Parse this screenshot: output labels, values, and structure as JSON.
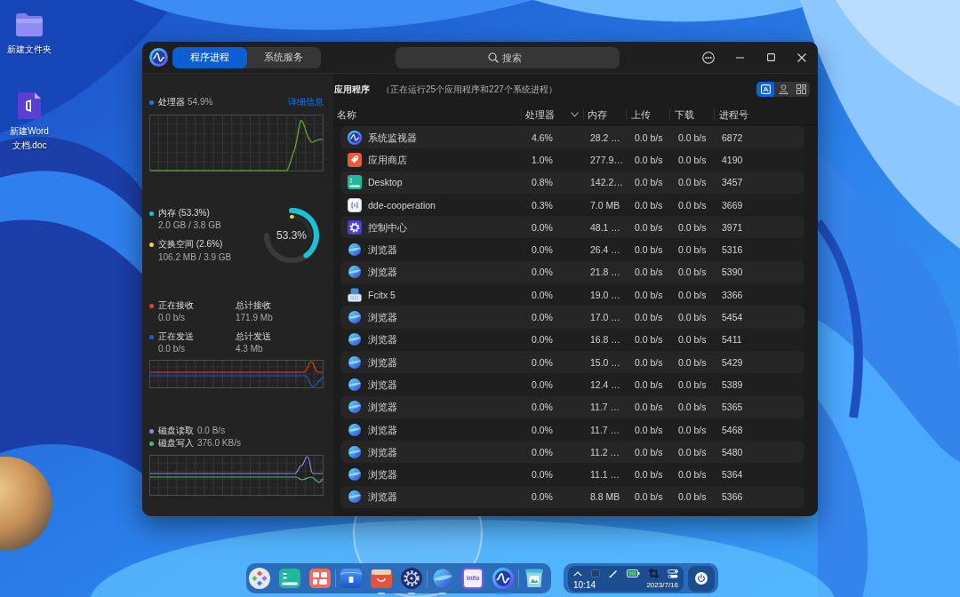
{
  "desktop": {
    "icons": [
      {
        "kind": "folder",
        "label": "新建文件夹"
      },
      {
        "kind": "document",
        "label": "新建Word文档.doc"
      }
    ]
  },
  "window": {
    "tabs": [
      {
        "label": "程序进程",
        "selected": true
      },
      {
        "label": "系统服务",
        "selected": false
      }
    ],
    "search": {
      "placeholder": "搜索"
    }
  },
  "sidebar": {
    "cpu": {
      "label": "处理器",
      "value": "54.9%",
      "color": "#1a7cf0",
      "link": "详细信息"
    },
    "memory": {
      "items": [
        {
          "label": "内存 (53.3%)",
          "detail": "2.0 GB / 3.8 GB",
          "color": "#18c3d8"
        },
        {
          "label": "交换空间 (2.6%)",
          "detail": "106.2 MB / 3.9 GB",
          "color": "#f2d23a"
        }
      ],
      "ring": {
        "label": "53.3%",
        "arcs": [
          {
            "level": 0.533
          },
          {
            "level": 0.026
          }
        ]
      }
    },
    "network": {
      "items": [
        {
          "label": "正在接收",
          "value": "0.0 b/s",
          "total_label": "总计接收",
          "total": "171.9 Mb",
          "color": "#d9481c"
        },
        {
          "label": "正在发送",
          "value": "0.0 b/s",
          "total_label": "总计发送",
          "total": "4.3 Mb",
          "color": "#1e5de0"
        }
      ]
    },
    "disk": {
      "items": [
        {
          "label": "磁盘读取",
          "value": "0.0 B/s",
          "color": "#8a88e8"
        },
        {
          "label": "磁盘写入",
          "value": "376.0 KB/s",
          "color": "#4fb879"
        }
      ]
    }
  },
  "processes": {
    "title": "应用程序",
    "summary": "（正在运行25个应用程序和227个系统进程）",
    "views": [
      {
        "kind": "apps",
        "selected": true
      },
      {
        "kind": "user",
        "selected": false
      },
      {
        "kind": "all",
        "selected": false
      }
    ],
    "columns": [
      {
        "label": "名称",
        "sorted": false
      },
      {
        "label": "处理器",
        "sorted": true
      },
      {
        "label": "内存",
        "sorted": false
      },
      {
        "label": "上传",
        "sorted": false
      },
      {
        "label": "下载",
        "sorted": false
      },
      {
        "label": "进程号",
        "sorted": false
      }
    ],
    "rows": [
      {
        "kind": "monitor",
        "name": "系统监视器",
        "cpu": "4.6%",
        "memory": "28.2 …",
        "upload": "0.0 b/s",
        "download": "0.0 b/s",
        "pid": "6872"
      },
      {
        "kind": "store",
        "name": "应用商店",
        "cpu": "1.0%",
        "memory": "277.9…",
        "upload": "0.0 b/s",
        "download": "0.0 b/s",
        "pid": "4190"
      },
      {
        "kind": "desktop",
        "name": "Desktop",
        "cpu": "0.8%",
        "memory": "142.2…",
        "upload": "0.0 b/s",
        "download": "0.0 b/s",
        "pid": "3457"
      },
      {
        "kind": "cooperation",
        "name": "dde-cooperation",
        "cpu": "0.3%",
        "memory": "7.0 MB",
        "upload": "0.0 b/s",
        "download": "0.0 b/s",
        "pid": "3669"
      },
      {
        "kind": "control",
        "name": "控制中心",
        "cpu": "0.0%",
        "memory": "48.1 …",
        "upload": "0.0 b/s",
        "download": "0.0 b/s",
        "pid": "3971"
      },
      {
        "kind": "browser",
        "name": "浏览器",
        "cpu": "0.0%",
        "memory": "26.4 …",
        "upload": "0.0 b/s",
        "download": "0.0 b/s",
        "pid": "5316"
      },
      {
        "kind": "browser",
        "name": "浏览器",
        "cpu": "0.0%",
        "memory": "21.8 …",
        "upload": "0.0 b/s",
        "download": "0.0 b/s",
        "pid": "5390"
      },
      {
        "kind": "keyboard",
        "name": "Fcitx 5",
        "cpu": "0.0%",
        "memory": "19.0 …",
        "upload": "0.0 b/s",
        "download": "0.0 b/s",
        "pid": "3366"
      },
      {
        "kind": "browser",
        "name": "浏览器",
        "cpu": "0.0%",
        "memory": "17.0 …",
        "upload": "0.0 b/s",
        "download": "0.0 b/s",
        "pid": "5454"
      },
      {
        "kind": "browser",
        "name": "浏览器",
        "cpu": "0.0%",
        "memory": "16.8 …",
        "upload": "0.0 b/s",
        "download": "0.0 b/s",
        "pid": "5411"
      },
      {
        "kind": "browser",
        "name": "浏览器",
        "cpu": "0.0%",
        "memory": "15.0 …",
        "upload": "0.0 b/s",
        "download": "0.0 b/s",
        "pid": "5429"
      },
      {
        "kind": "browser",
        "name": "浏览器",
        "cpu": "0.0%",
        "memory": "12.4 …",
        "upload": "0.0 b/s",
        "download": "0.0 b/s",
        "pid": "5389"
      },
      {
        "kind": "browser",
        "name": "浏览器",
        "cpu": "0.0%",
        "memory": "11.7 …",
        "upload": "0.0 b/s",
        "download": "0.0 b/s",
        "pid": "5365"
      },
      {
        "kind": "browser",
        "name": "浏览器",
        "cpu": "0.0%",
        "memory": "11.7 …",
        "upload": "0.0 b/s",
        "download": "0.0 b/s",
        "pid": "5468"
      },
      {
        "kind": "browser",
        "name": "浏览器",
        "cpu": "0.0%",
        "memory": "11.2 …",
        "upload": "0.0 b/s",
        "download": "0.0 b/s",
        "pid": "5480"
      },
      {
        "kind": "browser",
        "name": "浏览器",
        "cpu": "0.0%",
        "memory": "11.1 …",
        "upload": "0.0 b/s",
        "download": "0.0 b/s",
        "pid": "5364"
      },
      {
        "kind": "browser",
        "name": "浏览器",
        "cpu": "0.0%",
        "memory": "8.8 MB",
        "upload": "0.0 b/s",
        "download": "0.0 b/s",
        "pid": "5366"
      }
    ]
  },
  "dock": {
    "groups": [
      {
        "items": [
          {
            "kind": "launcher",
            "running": false,
            "active": false
          },
          {
            "kind": "desktop",
            "running": false,
            "active": false
          },
          {
            "kind": "multitask",
            "running": false,
            "active": false
          }
        ]
      },
      {
        "items": [
          {
            "kind": "files",
            "running": false,
            "active": false
          },
          {
            "kind": "store",
            "running": true,
            "active": false
          },
          {
            "kind": "settings",
            "running": true,
            "active": false
          }
        ]
      },
      {
        "items": [
          {
            "kind": "browser",
            "running": true,
            "active": false
          },
          {
            "kind": "info",
            "label": "info",
            "running": false,
            "active": false
          },
          {
            "kind": "monitor",
            "running": true,
            "active": true
          }
        ]
      },
      {
        "items": [
          {
            "kind": "viewer",
            "running": false,
            "active": false
          }
        ]
      }
    ]
  },
  "tray": {
    "time": "10:14",
    "date": "2023/7/16"
  }
}
